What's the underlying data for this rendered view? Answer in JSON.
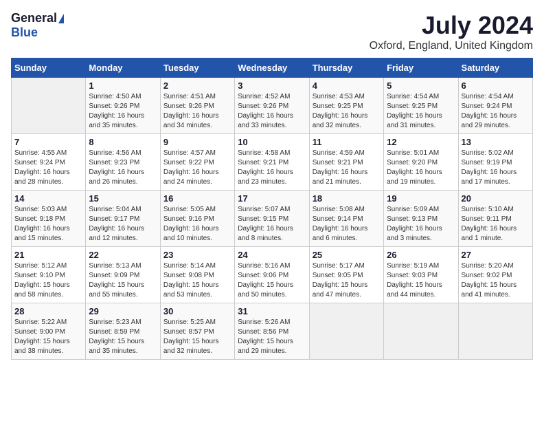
{
  "header": {
    "logo_general": "General",
    "logo_blue": "Blue",
    "month_year": "July 2024",
    "location": "Oxford, England, United Kingdom"
  },
  "days_of_week": [
    "Sunday",
    "Monday",
    "Tuesday",
    "Wednesday",
    "Thursday",
    "Friday",
    "Saturday"
  ],
  "weeks": [
    [
      {
        "day": "",
        "info": ""
      },
      {
        "day": "1",
        "info": "Sunrise: 4:50 AM\nSunset: 9:26 PM\nDaylight: 16 hours\nand 35 minutes."
      },
      {
        "day": "2",
        "info": "Sunrise: 4:51 AM\nSunset: 9:26 PM\nDaylight: 16 hours\nand 34 minutes."
      },
      {
        "day": "3",
        "info": "Sunrise: 4:52 AM\nSunset: 9:26 PM\nDaylight: 16 hours\nand 33 minutes."
      },
      {
        "day": "4",
        "info": "Sunrise: 4:53 AM\nSunset: 9:25 PM\nDaylight: 16 hours\nand 32 minutes."
      },
      {
        "day": "5",
        "info": "Sunrise: 4:54 AM\nSunset: 9:25 PM\nDaylight: 16 hours\nand 31 minutes."
      },
      {
        "day": "6",
        "info": "Sunrise: 4:54 AM\nSunset: 9:24 PM\nDaylight: 16 hours\nand 29 minutes."
      }
    ],
    [
      {
        "day": "7",
        "info": "Sunrise: 4:55 AM\nSunset: 9:24 PM\nDaylight: 16 hours\nand 28 minutes."
      },
      {
        "day": "8",
        "info": "Sunrise: 4:56 AM\nSunset: 9:23 PM\nDaylight: 16 hours\nand 26 minutes."
      },
      {
        "day": "9",
        "info": "Sunrise: 4:57 AM\nSunset: 9:22 PM\nDaylight: 16 hours\nand 24 minutes."
      },
      {
        "day": "10",
        "info": "Sunrise: 4:58 AM\nSunset: 9:21 PM\nDaylight: 16 hours\nand 23 minutes."
      },
      {
        "day": "11",
        "info": "Sunrise: 4:59 AM\nSunset: 9:21 PM\nDaylight: 16 hours\nand 21 minutes."
      },
      {
        "day": "12",
        "info": "Sunrise: 5:01 AM\nSunset: 9:20 PM\nDaylight: 16 hours\nand 19 minutes."
      },
      {
        "day": "13",
        "info": "Sunrise: 5:02 AM\nSunset: 9:19 PM\nDaylight: 16 hours\nand 17 minutes."
      }
    ],
    [
      {
        "day": "14",
        "info": "Sunrise: 5:03 AM\nSunset: 9:18 PM\nDaylight: 16 hours\nand 15 minutes."
      },
      {
        "day": "15",
        "info": "Sunrise: 5:04 AM\nSunset: 9:17 PM\nDaylight: 16 hours\nand 12 minutes."
      },
      {
        "day": "16",
        "info": "Sunrise: 5:05 AM\nSunset: 9:16 PM\nDaylight: 16 hours\nand 10 minutes."
      },
      {
        "day": "17",
        "info": "Sunrise: 5:07 AM\nSunset: 9:15 PM\nDaylight: 16 hours\nand 8 minutes."
      },
      {
        "day": "18",
        "info": "Sunrise: 5:08 AM\nSunset: 9:14 PM\nDaylight: 16 hours\nand 6 minutes."
      },
      {
        "day": "19",
        "info": "Sunrise: 5:09 AM\nSunset: 9:13 PM\nDaylight: 16 hours\nand 3 minutes."
      },
      {
        "day": "20",
        "info": "Sunrise: 5:10 AM\nSunset: 9:11 PM\nDaylight: 16 hours\nand 1 minute."
      }
    ],
    [
      {
        "day": "21",
        "info": "Sunrise: 5:12 AM\nSunset: 9:10 PM\nDaylight: 15 hours\nand 58 minutes."
      },
      {
        "day": "22",
        "info": "Sunrise: 5:13 AM\nSunset: 9:09 PM\nDaylight: 15 hours\nand 55 minutes."
      },
      {
        "day": "23",
        "info": "Sunrise: 5:14 AM\nSunset: 9:08 PM\nDaylight: 15 hours\nand 53 minutes."
      },
      {
        "day": "24",
        "info": "Sunrise: 5:16 AM\nSunset: 9:06 PM\nDaylight: 15 hours\nand 50 minutes."
      },
      {
        "day": "25",
        "info": "Sunrise: 5:17 AM\nSunset: 9:05 PM\nDaylight: 15 hours\nand 47 minutes."
      },
      {
        "day": "26",
        "info": "Sunrise: 5:19 AM\nSunset: 9:03 PM\nDaylight: 15 hours\nand 44 minutes."
      },
      {
        "day": "27",
        "info": "Sunrise: 5:20 AM\nSunset: 9:02 PM\nDaylight: 15 hours\nand 41 minutes."
      }
    ],
    [
      {
        "day": "28",
        "info": "Sunrise: 5:22 AM\nSunset: 9:00 PM\nDaylight: 15 hours\nand 38 minutes."
      },
      {
        "day": "29",
        "info": "Sunrise: 5:23 AM\nSunset: 8:59 PM\nDaylight: 15 hours\nand 35 minutes."
      },
      {
        "day": "30",
        "info": "Sunrise: 5:25 AM\nSunset: 8:57 PM\nDaylight: 15 hours\nand 32 minutes."
      },
      {
        "day": "31",
        "info": "Sunrise: 5:26 AM\nSunset: 8:56 PM\nDaylight: 15 hours\nand 29 minutes."
      },
      {
        "day": "",
        "info": ""
      },
      {
        "day": "",
        "info": ""
      },
      {
        "day": "",
        "info": ""
      }
    ]
  ]
}
